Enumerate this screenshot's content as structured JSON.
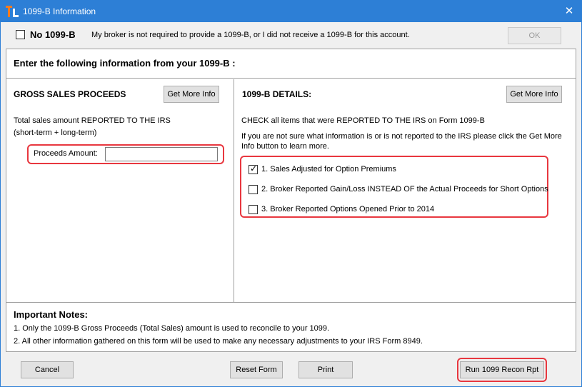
{
  "window": {
    "title": "1099-B Information"
  },
  "top": {
    "no1099_label": "No 1099-B",
    "no1099_desc": "My broker is not required to provide a 1099-B, or I did not receive a 1099-B for this account.",
    "no1099_checked": false,
    "ok_label": "OK"
  },
  "instruction": "Enter the following information from your 1099-B :",
  "gross": {
    "title": "GROSS SALES PROCEEDS",
    "info_button": "Get More Info",
    "desc_line1": "Total sales amount REPORTED TO THE IRS",
    "desc_line2": "(short-term + long-term)",
    "proceeds_label": "Proceeds Amount:",
    "proceeds_value": ""
  },
  "details": {
    "title": "1099-B DETAILS:",
    "info_button": "Get More Info",
    "check_text": "CHECK all items that were REPORTED TO THE IRS on Form 1099-B",
    "help_line1": "If you are not sure what information is or is not reported to the IRS please click the Get More",
    "help_line2": "Info button to learn more.",
    "options": [
      {
        "label": "1. Sales Adjusted for Option Premiums",
        "checked": true
      },
      {
        "label": "2. Broker Reported Gain/Loss INSTEAD OF the Actual Proceeds for Short Options",
        "checked": false
      },
      {
        "label": "3. Broker Reported Options Opened Prior to 2014",
        "checked": false
      }
    ]
  },
  "notes": {
    "title": "Important Notes:",
    "line1": "1. Only the 1099-B Gross Proceeds (Total Sales) amount is used to reconcile to your 1099.",
    "line2": "2. All other information gathered on this form will be used to make any necessary adjustments to your IRS Form 8949."
  },
  "buttons": {
    "cancel": "Cancel",
    "reset": "Reset Form",
    "print": "Print",
    "run": "Run 1099 Recon Rpt"
  },
  "colors": {
    "titlebar": "#2d7fd6",
    "highlight": "#e8373f",
    "app_icon_orange": "#f47b20"
  }
}
